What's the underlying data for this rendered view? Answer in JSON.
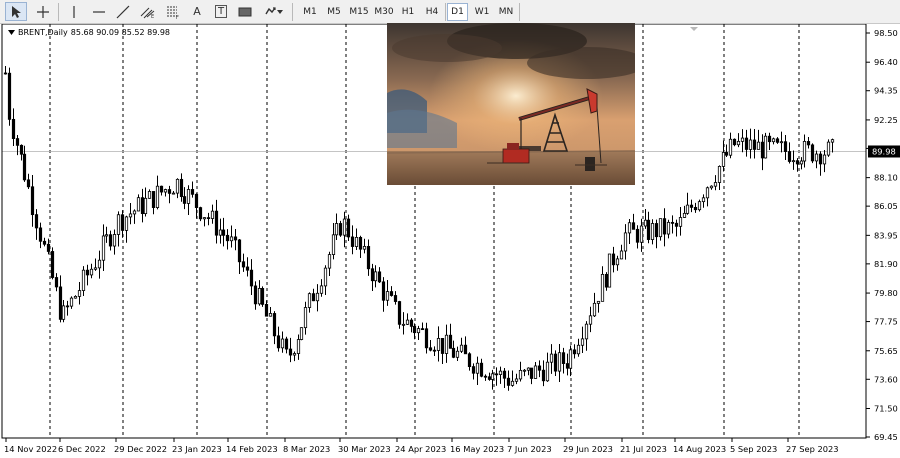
{
  "toolbar": {
    "tools": [
      {
        "name": "cursor-tool-icon",
        "active": true
      },
      {
        "name": "crosshair-tool-icon"
      },
      {
        "name": "vertical-line-tool-icon"
      },
      {
        "name": "horizontal-line-tool-icon"
      },
      {
        "name": "trendline-tool-icon"
      },
      {
        "name": "channels-tool-icon"
      },
      {
        "name": "fibonacci-tool-icon"
      },
      {
        "name": "text-tool-icon",
        "glyph": "A"
      },
      {
        "name": "text-label-tool-icon",
        "glyph": "T"
      },
      {
        "name": "rectangle-tool-icon"
      },
      {
        "name": "arrows-tool-icon"
      }
    ],
    "timeframes": [
      "M1",
      "M5",
      "M15",
      "M30",
      "H1",
      "H4",
      "D1",
      "W1",
      "MN"
    ],
    "active_timeframe": "D1"
  },
  "chart_info": {
    "symbol": "BRENT,Daily",
    "ohlc": "85.68 90.09 85.52 89.98"
  },
  "colors": {
    "candle": "#000000",
    "background": "#ffffff",
    "grid": "#000000",
    "price_label_bg": "#000000",
    "price_label_text": "#ffffff"
  },
  "chart_data": {
    "type": "candlestick",
    "current_price": "89.98",
    "y_ticks": [
      "98.50",
      "96.40",
      "94.35",
      "92.25",
      "90.20",
      "88.10",
      "86.05",
      "83.95",
      "81.90",
      "79.80",
      "77.75",
      "75.65",
      "73.60",
      "71.50",
      "69.45"
    ],
    "ylim": [
      69.45,
      98.5
    ],
    "x_labels": [
      "14 Nov 2022",
      "6 Dec 2022",
      "29 Dec 2022",
      "23 Jan 2023",
      "14 Feb 2023",
      "8 Mar 2023",
      "30 Mar 2023",
      "24 Apr 2023",
      "16 May 2023",
      "7 Jun 2023",
      "29 Jun 2023",
      "21 Jul 2023",
      "14 Aug 2023",
      "5 Sep 2023",
      "27 Sep 2023"
    ],
    "grid": "vertical dashed",
    "series": [
      {
        "label": "14 Nov 2022",
        "close": 93.0
      },
      {
        "label": "6 Dec 2022",
        "close": 78.0
      },
      {
        "label": "29 Dec 2022",
        "close": 85.0
      },
      {
        "label": "23 Jan 2023",
        "close": 87.8
      },
      {
        "label": "14 Feb 2023",
        "close": 83.5
      },
      {
        "label": "8 Mar 2023",
        "close": 75.0
      },
      {
        "label": "30 Mar 2023",
        "close": 85.0
      },
      {
        "label": "24 Apr 2023",
        "close": 78.0
      },
      {
        "label": "16 May 2023",
        "close": 75.5
      },
      {
        "label": "7 Jun 2023",
        "close": 73.5
      },
      {
        "label": "29 Jun 2023",
        "close": 75.0
      },
      {
        "label": "21 Jul 2023",
        "close": 84.0
      },
      {
        "label": "14 Aug 2023",
        "close": 84.5
      },
      {
        "label": "5 Sep 2023",
        "close": 90.5
      },
      {
        "label": "27 Sep 2023",
        "close": 89.98
      }
    ]
  }
}
